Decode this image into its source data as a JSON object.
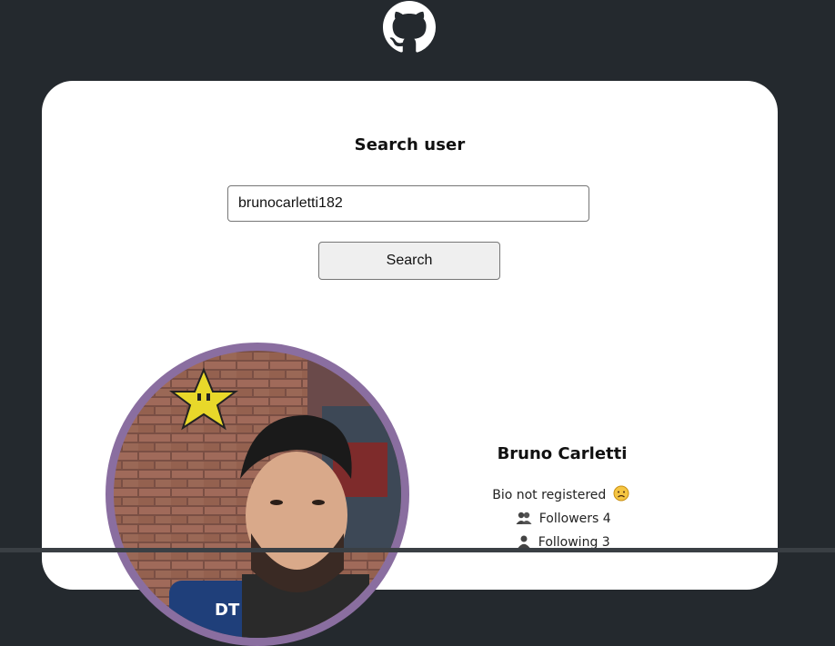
{
  "header": {
    "logo_icon": "github-octocat-icon"
  },
  "search": {
    "title": "Search user",
    "input_value": "brunocarletti182",
    "button_label": "Search"
  },
  "profile": {
    "avatar_icon": "user-avatar-photo",
    "name": "Bruno Carletti",
    "bio": "Bio not registered",
    "bio_icon": "sad-face-icon",
    "followers_label": "Followers 4",
    "followers_icon": "people-icon",
    "following_label": "Following 3",
    "following_icon": "person-icon"
  },
  "colors": {
    "page_background": "#24292e",
    "card_background": "#ffffff",
    "avatar_ring": "#8a6ea0"
  }
}
